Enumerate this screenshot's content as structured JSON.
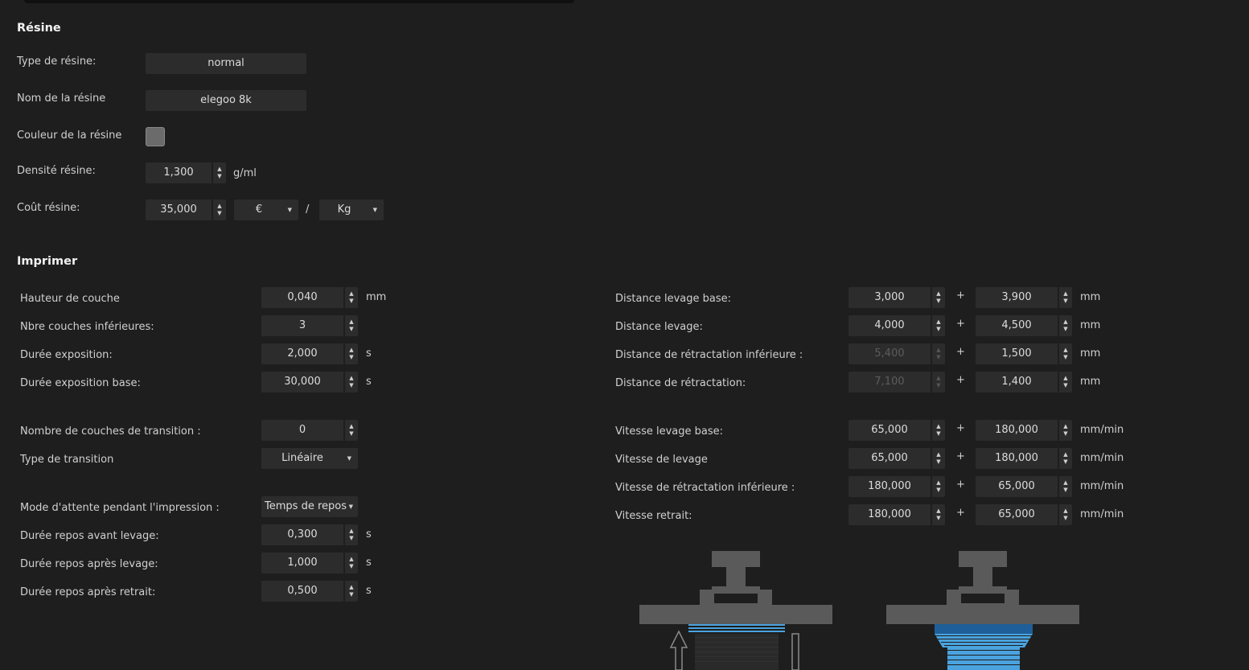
{
  "resin": {
    "title": "Résine",
    "type_label": "Type de résine:",
    "type_value": "normal",
    "name_label": "Nom de la résine",
    "name_value": "elegoo 8k",
    "color_label": "Couleur de la résine",
    "color_value": "#6b6b6b",
    "density_label": "Densité résine:",
    "density_value": "1,300",
    "density_unit": "g/ml",
    "cost_label": "Coût résine:",
    "cost_value": "35,000",
    "currency": "€",
    "slash": "/",
    "weight_unit": "Kg"
  },
  "print": {
    "title": "Imprimer",
    "plus": "+",
    "left": [
      {
        "label": "Hauteur de couche",
        "value": "0,040",
        "unit": "mm"
      },
      {
        "label": "Nbre couches inférieures:",
        "value": "3",
        "unit": ""
      },
      {
        "label": "Durée exposition:",
        "value": "2,000",
        "unit": "s"
      },
      {
        "label": "Durée exposition base:",
        "value": "30,000",
        "unit": "s"
      },
      {
        "label": "Nombre de couches de transition :",
        "value": "0",
        "unit": ""
      },
      {
        "label": "Type de transition",
        "value": "Linéaire",
        "unit": ""
      },
      {
        "label": "Mode d'attente pendant l'impression :",
        "value": "Temps de repos",
        "unit": ""
      },
      {
        "label": "Durée repos avant levage:",
        "value": "0,300",
        "unit": "s"
      },
      {
        "label": "Durée repos après levage:",
        "value": "1,000",
        "unit": "s"
      },
      {
        "label": "Durée repos après retrait:",
        "value": "0,500",
        "unit": "s"
      }
    ],
    "right": [
      {
        "label": "Distance levage base:",
        "value1": "3,000",
        "value2": "3,900",
        "unit": "mm"
      },
      {
        "label": "Distance levage:",
        "value1": "4,000",
        "value2": "4,500",
        "unit": "mm"
      },
      {
        "label": "Distance de rétractation inférieure :",
        "value1": "5,400",
        "value2": "1,500",
        "unit": "mm"
      },
      {
        "label": "Distance de rétractation:",
        "value1": "7,100",
        "value2": "1,400",
        "unit": "mm"
      },
      {
        "label": "Vitesse levage base:",
        "value1": "65,000",
        "value2": "180,000",
        "unit": "mm/min"
      },
      {
        "label": "Vitesse de levage",
        "value1": "65,000",
        "value2": "180,000",
        "unit": "mm/min"
      },
      {
        "label": "Vitesse de rétractation inférieure :",
        "value1": "180,000",
        "value2": "65,000",
        "unit": "mm/min"
      },
      {
        "label": "Vitesse retrait:",
        "value1": "180,000",
        "value2": "65,000",
        "unit": "mm/min"
      }
    ]
  },
  "colors": {
    "background": "#1e1e1e",
    "field": "#2c2c2c",
    "illustration_gray": "#5a5a5a",
    "resin_light_blue": "#4aa3df",
    "resin_dark_blue": "#1f5f99"
  }
}
